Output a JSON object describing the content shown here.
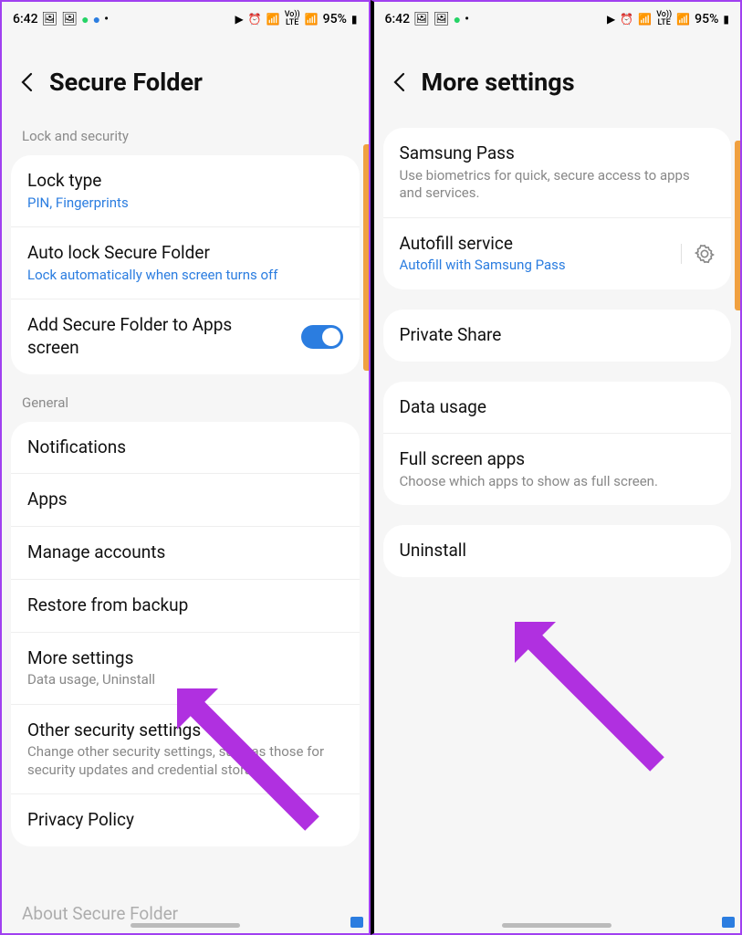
{
  "status": {
    "time": "6:42",
    "net_top": "Vo))",
    "net_bot": "LTE",
    "battery": "95%"
  },
  "left": {
    "title": "Secure Folder",
    "section1": "Lock and security",
    "lock_type": {
      "title": "Lock type",
      "sub": "PIN, Fingerprints"
    },
    "auto_lock": {
      "title": "Auto lock Secure Folder",
      "sub": "Lock automatically when screen turns off"
    },
    "add_apps": {
      "title": "Add Secure Folder to Apps screen"
    },
    "section2": "General",
    "notifications": "Notifications",
    "apps": "Apps",
    "manage": "Manage accounts",
    "restore": "Restore from backup",
    "more": {
      "title": "More settings",
      "sub": "Data usage, Uninstall"
    },
    "other": {
      "title": "Other security settings",
      "sub": "Change other security settings, such as those for security updates and credential storage."
    },
    "privacy": "Privacy Policy",
    "about": "About Secure Folder"
  },
  "right": {
    "title": "More settings",
    "samsung_pass": {
      "title": "Samsung Pass",
      "sub": "Use biometrics for quick, secure access to apps and services."
    },
    "autofill": {
      "title": "Autofill service",
      "sub": "Autofill with Samsung Pass"
    },
    "private_share": "Private Share",
    "data_usage": "Data usage",
    "fullscreen": {
      "title": "Full screen apps",
      "sub": "Choose which apps to show as full screen."
    },
    "uninstall": "Uninstall"
  }
}
